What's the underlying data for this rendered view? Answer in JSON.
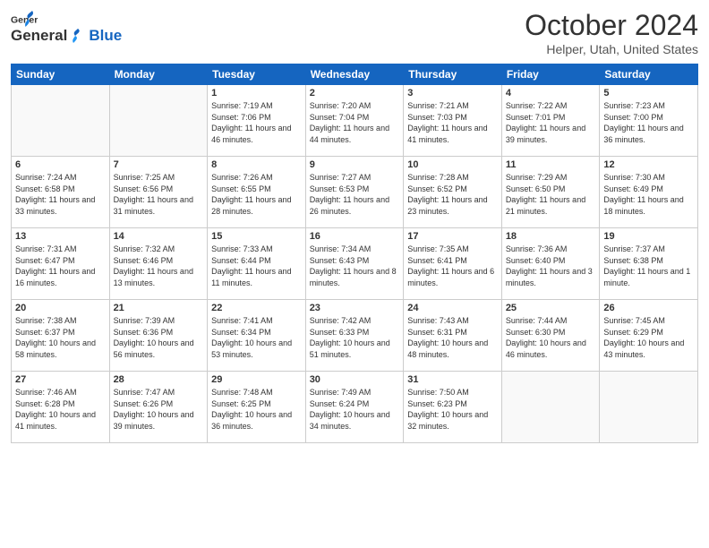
{
  "header": {
    "logo_general": "General",
    "logo_blue": "Blue",
    "month_title": "October 2024",
    "location": "Helper, Utah, United States"
  },
  "weekdays": [
    "Sunday",
    "Monday",
    "Tuesday",
    "Wednesday",
    "Thursday",
    "Friday",
    "Saturday"
  ],
  "weeks": [
    [
      {
        "day": "",
        "info": ""
      },
      {
        "day": "",
        "info": ""
      },
      {
        "day": "1",
        "info": "Sunrise: 7:19 AM\nSunset: 7:06 PM\nDaylight: 11 hours and 46 minutes."
      },
      {
        "day": "2",
        "info": "Sunrise: 7:20 AM\nSunset: 7:04 PM\nDaylight: 11 hours and 44 minutes."
      },
      {
        "day": "3",
        "info": "Sunrise: 7:21 AM\nSunset: 7:03 PM\nDaylight: 11 hours and 41 minutes."
      },
      {
        "day": "4",
        "info": "Sunrise: 7:22 AM\nSunset: 7:01 PM\nDaylight: 11 hours and 39 minutes."
      },
      {
        "day": "5",
        "info": "Sunrise: 7:23 AM\nSunset: 7:00 PM\nDaylight: 11 hours and 36 minutes."
      }
    ],
    [
      {
        "day": "6",
        "info": "Sunrise: 7:24 AM\nSunset: 6:58 PM\nDaylight: 11 hours and 33 minutes."
      },
      {
        "day": "7",
        "info": "Sunrise: 7:25 AM\nSunset: 6:56 PM\nDaylight: 11 hours and 31 minutes."
      },
      {
        "day": "8",
        "info": "Sunrise: 7:26 AM\nSunset: 6:55 PM\nDaylight: 11 hours and 28 minutes."
      },
      {
        "day": "9",
        "info": "Sunrise: 7:27 AM\nSunset: 6:53 PM\nDaylight: 11 hours and 26 minutes."
      },
      {
        "day": "10",
        "info": "Sunrise: 7:28 AM\nSunset: 6:52 PM\nDaylight: 11 hours and 23 minutes."
      },
      {
        "day": "11",
        "info": "Sunrise: 7:29 AM\nSunset: 6:50 PM\nDaylight: 11 hours and 21 minutes."
      },
      {
        "day": "12",
        "info": "Sunrise: 7:30 AM\nSunset: 6:49 PM\nDaylight: 11 hours and 18 minutes."
      }
    ],
    [
      {
        "day": "13",
        "info": "Sunrise: 7:31 AM\nSunset: 6:47 PM\nDaylight: 11 hours and 16 minutes."
      },
      {
        "day": "14",
        "info": "Sunrise: 7:32 AM\nSunset: 6:46 PM\nDaylight: 11 hours and 13 minutes."
      },
      {
        "day": "15",
        "info": "Sunrise: 7:33 AM\nSunset: 6:44 PM\nDaylight: 11 hours and 11 minutes."
      },
      {
        "day": "16",
        "info": "Sunrise: 7:34 AM\nSunset: 6:43 PM\nDaylight: 11 hours and 8 minutes."
      },
      {
        "day": "17",
        "info": "Sunrise: 7:35 AM\nSunset: 6:41 PM\nDaylight: 11 hours and 6 minutes."
      },
      {
        "day": "18",
        "info": "Sunrise: 7:36 AM\nSunset: 6:40 PM\nDaylight: 11 hours and 3 minutes."
      },
      {
        "day": "19",
        "info": "Sunrise: 7:37 AM\nSunset: 6:38 PM\nDaylight: 11 hours and 1 minute."
      }
    ],
    [
      {
        "day": "20",
        "info": "Sunrise: 7:38 AM\nSunset: 6:37 PM\nDaylight: 10 hours and 58 minutes."
      },
      {
        "day": "21",
        "info": "Sunrise: 7:39 AM\nSunset: 6:36 PM\nDaylight: 10 hours and 56 minutes."
      },
      {
        "day": "22",
        "info": "Sunrise: 7:41 AM\nSunset: 6:34 PM\nDaylight: 10 hours and 53 minutes."
      },
      {
        "day": "23",
        "info": "Sunrise: 7:42 AM\nSunset: 6:33 PM\nDaylight: 10 hours and 51 minutes."
      },
      {
        "day": "24",
        "info": "Sunrise: 7:43 AM\nSunset: 6:31 PM\nDaylight: 10 hours and 48 minutes."
      },
      {
        "day": "25",
        "info": "Sunrise: 7:44 AM\nSunset: 6:30 PM\nDaylight: 10 hours and 46 minutes."
      },
      {
        "day": "26",
        "info": "Sunrise: 7:45 AM\nSunset: 6:29 PM\nDaylight: 10 hours and 43 minutes."
      }
    ],
    [
      {
        "day": "27",
        "info": "Sunrise: 7:46 AM\nSunset: 6:28 PM\nDaylight: 10 hours and 41 minutes."
      },
      {
        "day": "28",
        "info": "Sunrise: 7:47 AM\nSunset: 6:26 PM\nDaylight: 10 hours and 39 minutes."
      },
      {
        "day": "29",
        "info": "Sunrise: 7:48 AM\nSunset: 6:25 PM\nDaylight: 10 hours and 36 minutes."
      },
      {
        "day": "30",
        "info": "Sunrise: 7:49 AM\nSunset: 6:24 PM\nDaylight: 10 hours and 34 minutes."
      },
      {
        "day": "31",
        "info": "Sunrise: 7:50 AM\nSunset: 6:23 PM\nDaylight: 10 hours and 32 minutes."
      },
      {
        "day": "",
        "info": ""
      },
      {
        "day": "",
        "info": ""
      }
    ]
  ]
}
